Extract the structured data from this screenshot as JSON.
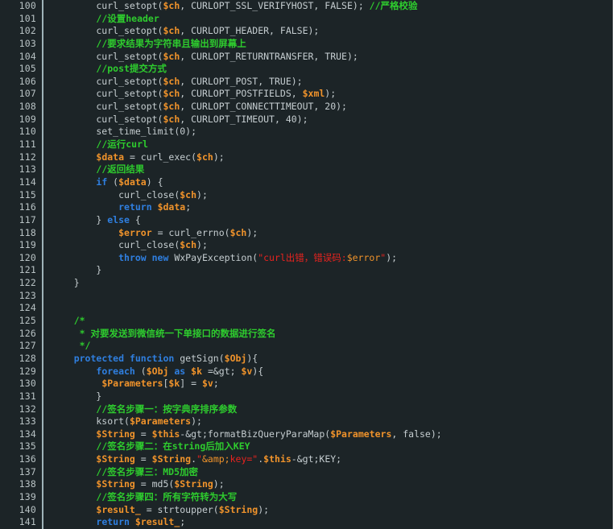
{
  "editor": {
    "language": "PHP",
    "first_line_number": 100,
    "last_line_number": 141,
    "theme": {
      "background": "#1c2427",
      "gutter_text": "#b8c2c4",
      "gutter_divider": "#9fb3b8",
      "left_rail": "#4a6169",
      "default_text": "#c5cdd0",
      "comment": "#2ecc2e",
      "keyword": "#2f7fe0",
      "variable": "#f0932b",
      "string": "#e8231f",
      "escape": "#f0932b",
      "page_edge": "#ffffff"
    }
  },
  "lines": [
    {
      "num": "100",
      "tokens": [
        {
          "t": "plain",
          "s": "        curl_setopt("
        },
        {
          "t": "var",
          "s": "$ch"
        },
        {
          "t": "plain",
          "s": ", CURLOPT_SSL_VERIFYHOST, FALSE); "
        },
        {
          "t": "comment",
          "s": "//严格校验"
        }
      ]
    },
    {
      "num": "101",
      "tokens": [
        {
          "t": "plain",
          "s": "        "
        },
        {
          "t": "comment",
          "s": "//设置header"
        }
      ]
    },
    {
      "num": "102",
      "tokens": [
        {
          "t": "plain",
          "s": "        curl_setopt("
        },
        {
          "t": "var",
          "s": "$ch"
        },
        {
          "t": "plain",
          "s": ", CURLOPT_HEADER, FALSE);"
        }
      ]
    },
    {
      "num": "103",
      "tokens": [
        {
          "t": "plain",
          "s": "        "
        },
        {
          "t": "comment",
          "s": "//要求结果为字符串且输出到屏幕上"
        }
      ]
    },
    {
      "num": "104",
      "tokens": [
        {
          "t": "plain",
          "s": "        curl_setopt("
        },
        {
          "t": "var",
          "s": "$ch"
        },
        {
          "t": "plain",
          "s": ", CURLOPT_RETURNTRANSFER, TRUE);"
        }
      ]
    },
    {
      "num": "105",
      "tokens": [
        {
          "t": "plain",
          "s": "        "
        },
        {
          "t": "comment",
          "s": "//post提交方式"
        }
      ]
    },
    {
      "num": "106",
      "tokens": [
        {
          "t": "plain",
          "s": "        curl_setopt("
        },
        {
          "t": "var",
          "s": "$ch"
        },
        {
          "t": "plain",
          "s": ", CURLOPT_POST, TRUE);"
        }
      ]
    },
    {
      "num": "107",
      "tokens": [
        {
          "t": "plain",
          "s": "        curl_setopt("
        },
        {
          "t": "var",
          "s": "$ch"
        },
        {
          "t": "plain",
          "s": ", CURLOPT_POSTFIELDS, "
        },
        {
          "t": "var",
          "s": "$xml"
        },
        {
          "t": "plain",
          "s": ");"
        }
      ]
    },
    {
      "num": "108",
      "tokens": [
        {
          "t": "plain",
          "s": "        curl_setopt("
        },
        {
          "t": "var",
          "s": "$ch"
        },
        {
          "t": "plain",
          "s": ", CURLOPT_CONNECTTIMEOUT, 20);"
        }
      ]
    },
    {
      "num": "109",
      "tokens": [
        {
          "t": "plain",
          "s": "        curl_setopt("
        },
        {
          "t": "var",
          "s": "$ch"
        },
        {
          "t": "plain",
          "s": ", CURLOPT_TIMEOUT, 40);"
        }
      ]
    },
    {
      "num": "110",
      "tokens": [
        {
          "t": "plain",
          "s": "        set_time_limit(0);"
        }
      ]
    },
    {
      "num": "111",
      "tokens": [
        {
          "t": "plain",
          "s": "        "
        },
        {
          "t": "comment",
          "s": "//运行curl"
        }
      ]
    },
    {
      "num": "112",
      "tokens": [
        {
          "t": "plain",
          "s": "        "
        },
        {
          "t": "var",
          "s": "$data"
        },
        {
          "t": "plain",
          "s": " = curl_exec("
        },
        {
          "t": "var",
          "s": "$ch"
        },
        {
          "t": "plain",
          "s": ");"
        }
      ]
    },
    {
      "num": "113",
      "tokens": [
        {
          "t": "plain",
          "s": "        "
        },
        {
          "t": "comment",
          "s": "//返回结果"
        }
      ]
    },
    {
      "num": "114",
      "tokens": [
        {
          "t": "plain",
          "s": "        "
        },
        {
          "t": "kw",
          "s": "if"
        },
        {
          "t": "plain",
          "s": " ("
        },
        {
          "t": "var",
          "s": "$data"
        },
        {
          "t": "plain",
          "s": ") {"
        }
      ]
    },
    {
      "num": "115",
      "tokens": [
        {
          "t": "plain",
          "s": "            curl_close("
        },
        {
          "t": "var",
          "s": "$ch"
        },
        {
          "t": "plain",
          "s": ");"
        }
      ]
    },
    {
      "num": "116",
      "tokens": [
        {
          "t": "plain",
          "s": "            "
        },
        {
          "t": "kw",
          "s": "return"
        },
        {
          "t": "plain",
          "s": " "
        },
        {
          "t": "var",
          "s": "$data"
        },
        {
          "t": "plain",
          "s": ";"
        }
      ]
    },
    {
      "num": "117",
      "tokens": [
        {
          "t": "plain",
          "s": "        } "
        },
        {
          "t": "kw",
          "s": "else"
        },
        {
          "t": "plain",
          "s": " {"
        }
      ]
    },
    {
      "num": "118",
      "tokens": [
        {
          "t": "plain",
          "s": "            "
        },
        {
          "t": "var",
          "s": "$error"
        },
        {
          "t": "plain",
          "s": " = curl_errno("
        },
        {
          "t": "var",
          "s": "$ch"
        },
        {
          "t": "plain",
          "s": ");"
        }
      ]
    },
    {
      "num": "119",
      "tokens": [
        {
          "t": "plain",
          "s": "            curl_close("
        },
        {
          "t": "var",
          "s": "$ch"
        },
        {
          "t": "plain",
          "s": ");"
        }
      ]
    },
    {
      "num": "120",
      "tokens": [
        {
          "t": "plain",
          "s": "            "
        },
        {
          "t": "kw",
          "s": "throw new"
        },
        {
          "t": "plain",
          "s": " WxPayException("
        },
        {
          "t": "str",
          "s": "\"curl出错，错误码:"
        },
        {
          "t": "esc",
          "s": "$error"
        },
        {
          "t": "str",
          "s": "\""
        },
        {
          "t": "plain",
          "s": ");"
        }
      ]
    },
    {
      "num": "121",
      "tokens": [
        {
          "t": "plain",
          "s": "        }"
        }
      ]
    },
    {
      "num": "122",
      "tokens": [
        {
          "t": "plain",
          "s": "    }"
        }
      ]
    },
    {
      "num": "123",
      "tokens": [
        {
          "t": "plain",
          "s": ""
        }
      ]
    },
    {
      "num": "124",
      "tokens": [
        {
          "t": "plain",
          "s": ""
        }
      ]
    },
    {
      "num": "125",
      "tokens": [
        {
          "t": "plain",
          "s": "    "
        },
        {
          "t": "comment",
          "s": "/*"
        }
      ]
    },
    {
      "num": "126",
      "tokens": [
        {
          "t": "plain",
          "s": "     "
        },
        {
          "t": "comment",
          "s": "* 对要发送到微信统一下单接口的数据进行签名"
        }
      ]
    },
    {
      "num": "127",
      "tokens": [
        {
          "t": "plain",
          "s": "     "
        },
        {
          "t": "comment",
          "s": "*/"
        }
      ]
    },
    {
      "num": "128",
      "tokens": [
        {
          "t": "plain",
          "s": "    "
        },
        {
          "t": "kw",
          "s": "protected function"
        },
        {
          "t": "plain",
          "s": " getSign("
        },
        {
          "t": "var",
          "s": "$Obj"
        },
        {
          "t": "plain",
          "s": "){"
        }
      ]
    },
    {
      "num": "129",
      "tokens": [
        {
          "t": "plain",
          "s": "        "
        },
        {
          "t": "kw",
          "s": "foreach"
        },
        {
          "t": "plain",
          "s": " ("
        },
        {
          "t": "var",
          "s": "$Obj"
        },
        {
          "t": "plain",
          "s": " "
        },
        {
          "t": "kw",
          "s": "as"
        },
        {
          "t": "plain",
          "s": " "
        },
        {
          "t": "var",
          "s": "$k"
        },
        {
          "t": "plain",
          "s": " =&gt; "
        },
        {
          "t": "var",
          "s": "$v"
        },
        {
          "t": "plain",
          "s": "){"
        }
      ]
    },
    {
      "num": "130",
      "tokens": [
        {
          "t": "plain",
          "s": "         "
        },
        {
          "t": "var",
          "s": "$Parameters"
        },
        {
          "t": "plain",
          "s": "["
        },
        {
          "t": "var",
          "s": "$k"
        },
        {
          "t": "plain",
          "s": "] = "
        },
        {
          "t": "var",
          "s": "$v"
        },
        {
          "t": "plain",
          "s": ";"
        }
      ]
    },
    {
      "num": "131",
      "tokens": [
        {
          "t": "plain",
          "s": "        }"
        }
      ]
    },
    {
      "num": "132",
      "tokens": [
        {
          "t": "plain",
          "s": "        "
        },
        {
          "t": "comment",
          "s": "//签名步骤一：按字典序排序参数"
        }
      ]
    },
    {
      "num": "133",
      "tokens": [
        {
          "t": "plain",
          "s": "        ksort("
        },
        {
          "t": "var",
          "s": "$Parameters"
        },
        {
          "t": "plain",
          "s": ");"
        }
      ]
    },
    {
      "num": "134",
      "tokens": [
        {
          "t": "plain",
          "s": "        "
        },
        {
          "t": "var",
          "s": "$String"
        },
        {
          "t": "plain",
          "s": " = "
        },
        {
          "t": "var",
          "s": "$this"
        },
        {
          "t": "plain",
          "s": "-&gt;formatBizQueryParaMap("
        },
        {
          "t": "var",
          "s": "$Parameters"
        },
        {
          "t": "plain",
          "s": ", false);"
        }
      ]
    },
    {
      "num": "135",
      "tokens": [
        {
          "t": "plain",
          "s": "        "
        },
        {
          "t": "comment",
          "s": "//签名步骤二：在string后加入KEY"
        }
      ]
    },
    {
      "num": "136",
      "tokens": [
        {
          "t": "plain",
          "s": "        "
        },
        {
          "t": "var",
          "s": "$String"
        },
        {
          "t": "plain",
          "s": " = "
        },
        {
          "t": "var",
          "s": "$String"
        },
        {
          "t": "plain",
          "s": "."
        },
        {
          "t": "str",
          "s": "\""
        },
        {
          "t": "esc",
          "s": "&amp;"
        },
        {
          "t": "str",
          "s": "key=\""
        },
        {
          "t": "plain",
          "s": "."
        },
        {
          "t": "var",
          "s": "$this"
        },
        {
          "t": "plain",
          "s": "-&gt;KEY;"
        }
      ]
    },
    {
      "num": "137",
      "tokens": [
        {
          "t": "plain",
          "s": "        "
        },
        {
          "t": "comment",
          "s": "//签名步骤三：MD5加密"
        }
      ]
    },
    {
      "num": "138",
      "tokens": [
        {
          "t": "plain",
          "s": "        "
        },
        {
          "t": "var",
          "s": "$String"
        },
        {
          "t": "plain",
          "s": " = md5("
        },
        {
          "t": "var",
          "s": "$String"
        },
        {
          "t": "plain",
          "s": ");"
        }
      ]
    },
    {
      "num": "139",
      "tokens": [
        {
          "t": "plain",
          "s": "        "
        },
        {
          "t": "comment",
          "s": "//签名步骤四：所有字符转为大写"
        }
      ]
    },
    {
      "num": "140",
      "tokens": [
        {
          "t": "plain",
          "s": "        "
        },
        {
          "t": "var",
          "s": "$result_"
        },
        {
          "t": "plain",
          "s": " = strtoupper("
        },
        {
          "t": "var",
          "s": "$String"
        },
        {
          "t": "plain",
          "s": ");"
        }
      ]
    },
    {
      "num": "141",
      "tokens": [
        {
          "t": "plain",
          "s": "        "
        },
        {
          "t": "kw",
          "s": "return"
        },
        {
          "t": "plain",
          "s": " "
        },
        {
          "t": "var",
          "s": "$result_"
        },
        {
          "t": "plain",
          "s": ";"
        }
      ]
    }
  ]
}
